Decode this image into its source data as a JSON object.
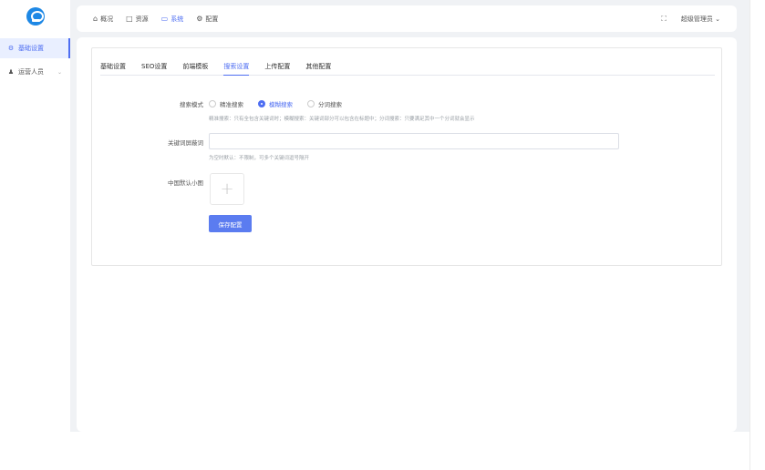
{
  "sidebar": {
    "items": [
      {
        "label": "基础设置",
        "icon": "settings-icon"
      },
      {
        "label": "运营人员",
        "icon": "user-icon"
      }
    ]
  },
  "topnav": {
    "items": [
      {
        "label": "概况",
        "icon": "home-icon"
      },
      {
        "label": "资源",
        "icon": "folder-icon"
      },
      {
        "label": "系统",
        "icon": "monitor-icon"
      },
      {
        "label": "配置",
        "icon": "gear-icon"
      }
    ],
    "user": "超级管理员"
  },
  "tabs": [
    "基础设置",
    "SEO设置",
    "前端模板",
    "搜索设置",
    "上传配置",
    "其他配置"
  ],
  "form": {
    "search_mode_label": "搜索模式",
    "search_mode_options": [
      "精准搜索",
      "模糊搜索",
      "分词搜索"
    ],
    "search_mode_hint": "精准搜索：只有全包含关键词时；模糊搜索：关键词部分可以包含在标题中；分词搜索：只要满足其中一个分词就会显示",
    "search_word_label": "关键词屏蔽词",
    "search_word_value": "",
    "search_word_hint": "为空时默认：不限制，可多个关键词逗号隔开",
    "image_label": "中国默认小图",
    "save_label": "保存配置"
  },
  "colors": {
    "accent": "#4e6ef2",
    "button": "#5b7cf0"
  }
}
